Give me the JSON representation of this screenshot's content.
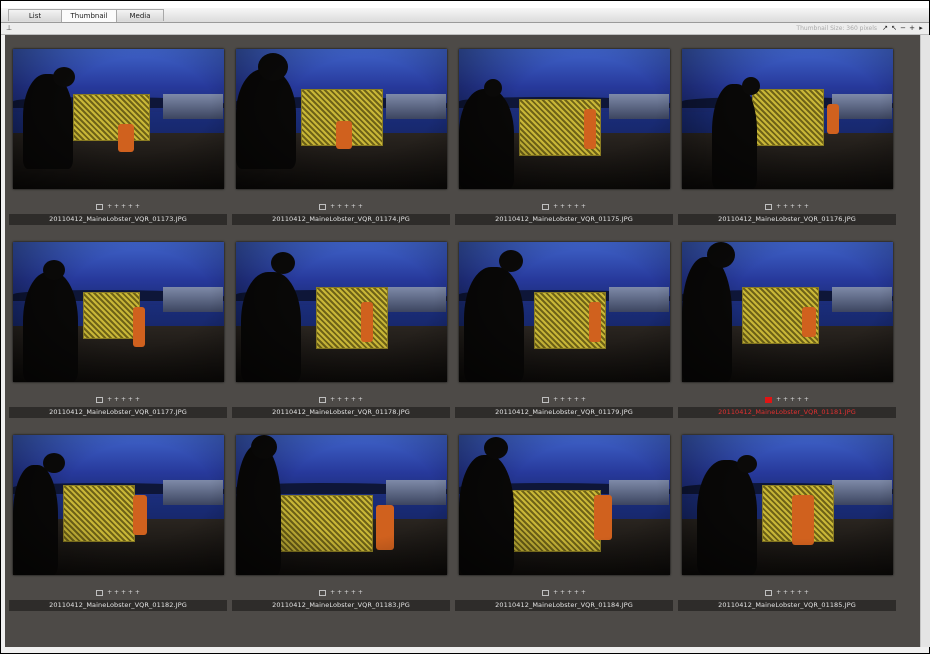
{
  "tabs": [
    {
      "label": "List",
      "active": false
    },
    {
      "label": "Thumbnail",
      "active": true
    },
    {
      "label": "Media",
      "active": false
    }
  ],
  "toolbar": {
    "pin_icon": "pin-icon",
    "size_label": "Thumbnail Size: 360 pixels",
    "buttons": [
      {
        "name": "expand-icon",
        "glyph": "↗"
      },
      {
        "name": "shrink-icon",
        "glyph": "↖"
      },
      {
        "name": "zoom-out-icon",
        "glyph": "−"
      },
      {
        "name": "zoom-in-icon",
        "glyph": "+"
      },
      {
        "name": "menu-arrow-icon",
        "glyph": "▸"
      }
    ]
  },
  "thumbnails": [
    {
      "filename": "20110412_MaineLobster_VQR_01173.JPG",
      "marks": "+ + + + +",
      "selected": false
    },
    {
      "filename": "20110412_MaineLobster_VQR_01174.JPG",
      "marks": "+ + + + +",
      "selected": false
    },
    {
      "filename": "20110412_MaineLobster_VQR_01175.JPG",
      "marks": "+ + + + +",
      "selected": false
    },
    {
      "filename": "20110412_MaineLobster_VQR_01176.JPG",
      "marks": "+ + + + +",
      "selected": false
    },
    {
      "filename": "20110412_MaineLobster_VQR_01177.JPG",
      "marks": "+ + + + +",
      "selected": false
    },
    {
      "filename": "20110412_MaineLobster_VQR_01178.JPG",
      "marks": "+ + + + +",
      "selected": false
    },
    {
      "filename": "20110412_MaineLobster_VQR_01179.JPG",
      "marks": "+ + + + +",
      "selected": false
    },
    {
      "filename": "20110412_MaineLobster_VQR_01181.JPG",
      "marks": "+ + + + +",
      "selected": true
    },
    {
      "filename": "20110412_MaineLobster_VQR_01182.JPG",
      "marks": "+ + + + +",
      "selected": false
    },
    {
      "filename": "20110412_MaineLobster_VQR_01183.JPG",
      "marks": "+ + + + +",
      "selected": false
    },
    {
      "filename": "20110412_MaineLobster_VQR_01184.JPG",
      "marks": "+ + + + +",
      "selected": false
    },
    {
      "filename": "20110412_MaineLobster_VQR_01185.JPG",
      "marks": "+ + + + +",
      "selected": false
    }
  ],
  "colors": {
    "grid_background": "#4d4a47",
    "selected_flag": "#e01414",
    "caption_bar": "#2e2c2a"
  }
}
